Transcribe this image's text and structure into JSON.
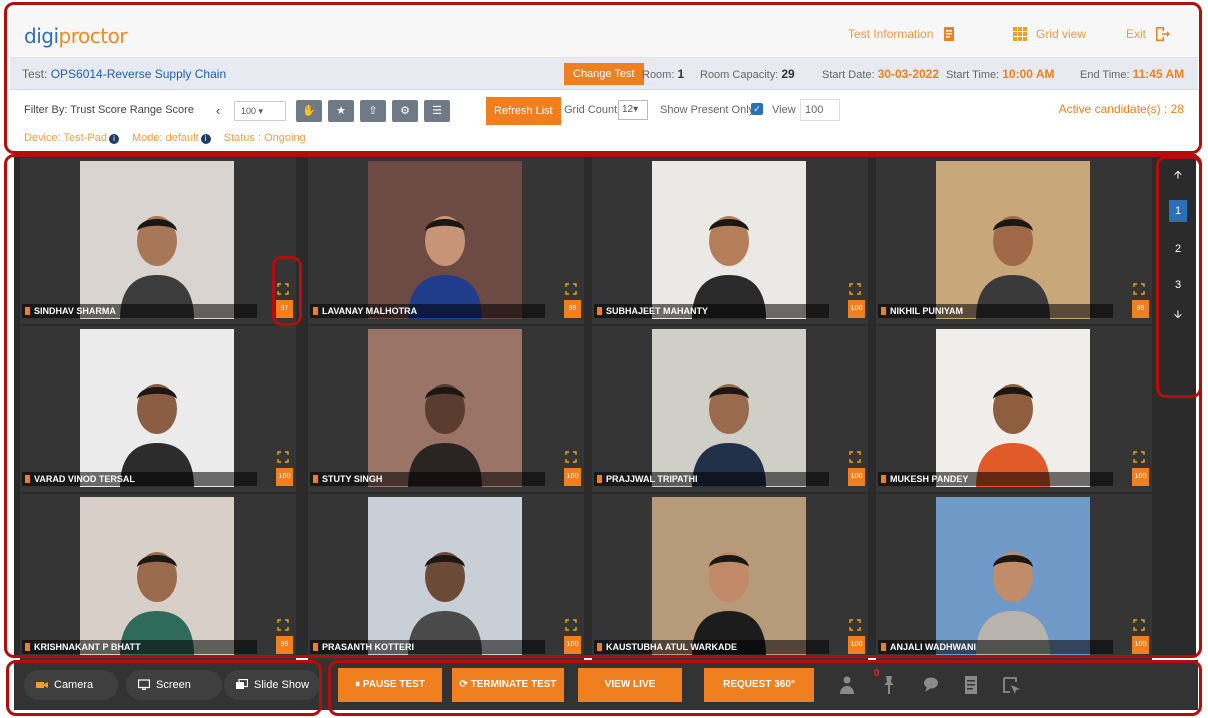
{
  "app": {
    "logo_part1": "digi",
    "logo_part2": "proctor",
    "links": {
      "test_information": "Test Information",
      "grid_view": "Grid view",
      "exit": "Exit"
    }
  },
  "test_bar": {
    "test_label": "Test:",
    "test_name": "OPS6014-Reverse Supply Chain",
    "change_test": "Change Test",
    "room_label": "Room:",
    "room_value": "1",
    "capacity_label": "Room Capacity:",
    "capacity_value": "29",
    "start_date_label": "Start Date:",
    "start_date_value": "30-03-2022",
    "start_time_label": "Start Time:",
    "start_time_value": "10:00 AM",
    "end_time_label": "End Time:",
    "end_time_value": "11:45 AM"
  },
  "filters": {
    "filter_label": "Filter By: Trust Score Range Score",
    "score_select": "100",
    "refresh_list": "Refresh List",
    "grid_count_label": "Grid Count",
    "grid_count_value": "12",
    "show_present_only": "Show Present Only",
    "view_label": "View",
    "view_value": "100",
    "active_candidates": "Active candidate(s) : 28"
  },
  "status_row": {
    "device": "Device: Test-Pad",
    "mode": "Mode: default",
    "status": "Status : Ongoing"
  },
  "candidates": [
    {
      "name": "SINDHAV SHARMA",
      "score": "97",
      "skin": "#a87758",
      "bg": "#d9d4cf",
      "shirt": "#3c3c3c"
    },
    {
      "name": "LAVANAY MALHOTRA",
      "score": "99",
      "skin": "#c89478",
      "bg": "#6e4a44",
      "shirt": "#1f3d8a"
    },
    {
      "name": "SUBHAJEET MAHANTY",
      "score": "100",
      "skin": "#b57e5b",
      "bg": "#ebe9e6",
      "shirt": "#2a2a2a"
    },
    {
      "name": "NIKHIL PUNIYAM",
      "score": "99",
      "skin": "#a06a4a",
      "bg": "#c8a77a",
      "shirt": "#3a3a3a"
    },
    {
      "name": "VARAD VINOD TERSAL",
      "score": "100",
      "skin": "#8b5e43",
      "bg": "#ebebeb",
      "shirt": "#2c2c2c"
    },
    {
      "name": "STUTY SINGH",
      "score": "100",
      "skin": "#5a3d2f",
      "bg": "#9a7466",
      "shirt": "#2a2422"
    },
    {
      "name": "PRAJJWAL TRIPATHI",
      "score": "100",
      "skin": "#9a6a4c",
      "bg": "#cfcfc8",
      "shirt": "#22304a"
    },
    {
      "name": "MUKESH PANDEY",
      "score": "100",
      "skin": "#8e5e3f",
      "bg": "#efeeea",
      "shirt": "#e05a2a"
    },
    {
      "name": "KRISHNAKANT P BHATT",
      "score": "99",
      "skin": "#9a6a4c",
      "bg": "#d8cfc8",
      "shirt": "#2f6b5a"
    },
    {
      "name": "PRASANTH KOTTERI",
      "score": "100",
      "skin": "#6c4a38",
      "bg": "#c9cfd6",
      "shirt": "#4a4a4a"
    },
    {
      "name": "KAUSTUBHA ATUL WARKADE",
      "score": "100",
      "skin": "#c08a68",
      "bg": "#b79a7a",
      "shirt": "#1c1c1c"
    },
    {
      "name": "ANJALI WADHWANI",
      "score": "100",
      "skin": "#c08c6a",
      "bg": "#6f9ac8",
      "shirt": "#b8b4ad"
    }
  ],
  "pager": {
    "pages": [
      "1",
      "2",
      "3"
    ],
    "current": "1"
  },
  "bottom_bar": {
    "camera": "Camera",
    "screen": "Screen",
    "slide_show": "Slide Show",
    "pause_test": "PAUSE TEST",
    "terminate_test": "TERMINATE TEST",
    "view_live": "VIEW LIVE",
    "request_360": "REQUEST 360°",
    "notification_count": "0"
  },
  "colors": {
    "accent": "#f0801f",
    "brand_blue": "#2c6fb7",
    "grid_bg": "#2b2b2b",
    "annotation_red": "#b50c0c"
  }
}
